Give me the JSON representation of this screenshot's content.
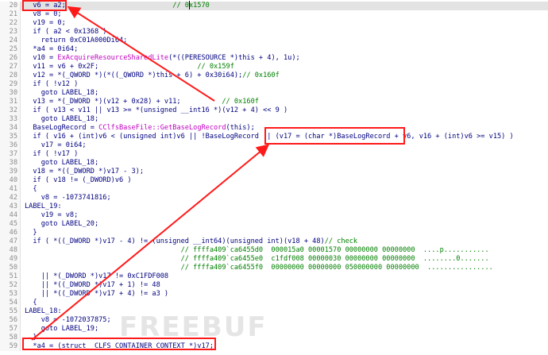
{
  "watermark": "FREEBUF",
  "lines": [
    {
      "n": "20",
      "hl": true,
      "p": [
        {
          "t": "  v6 = a2;                          "
        },
        {
          "t": "// 0x1570",
          "c": "cmt"
        }
      ]
    },
    {
      "n": "21",
      "p": [
        {
          "t": "  v8 = 0;"
        }
      ]
    },
    {
      "n": "22",
      "p": [
        {
          "t": "  v19 = 0;"
        }
      ]
    },
    {
      "n": "23",
      "p": [
        {
          "t": "  if ( a2 < 0x1368 )"
        }
      ]
    },
    {
      "n": "24",
      "p": [
        {
          "t": "    return 0xC01A000Di64;"
        }
      ]
    },
    {
      "n": "25",
      "p": [
        {
          "t": "  *a4 = 0i64;"
        }
      ]
    },
    {
      "n": "26",
      "p": [
        {
          "t": "  v10 = "
        },
        {
          "t": "ExAcquireResourceSharedLite",
          "c": "fn"
        },
        {
          "t": "(*((PERESOURCE *)this + 4), 1u);"
        }
      ]
    },
    {
      "n": "27",
      "p": [
        {
          "t": "  v11 = v6 + 0x2F;                        "
        },
        {
          "t": "// 0x159f",
          "c": "cmt"
        }
      ]
    },
    {
      "n": "28",
      "p": [
        {
          "t": "  v12 = *(_QWORD *)(*((_QWORD *)this + 6) + 0x30i64);"
        },
        {
          "t": "// 0x160f",
          "c": "cmt"
        }
      ]
    },
    {
      "n": "29",
      "p": [
        {
          "t": "  if ( !v12 )"
        }
      ]
    },
    {
      "n": "30",
      "p": [
        {
          "t": "    goto LABEL_18;"
        }
      ]
    },
    {
      "n": "31",
      "p": [
        {
          "t": "  v13 = *(_DWORD *)(v12 + 0x28) + v11;          "
        },
        {
          "t": "// 0x160f",
          "c": "cmt"
        }
      ]
    },
    {
      "n": "32",
      "p": [
        {
          "t": "  if ( v13 < v11 || v13 >= *(unsigned __int16 *)(v12 + 4) << 9 )"
        }
      ]
    },
    {
      "n": "33",
      "p": [
        {
          "t": "    goto LABEL_18;"
        }
      ]
    },
    {
      "n": "34",
      "p": [
        {
          "t": "  BaseLogRecord = "
        },
        {
          "t": "CClfsBaseFile::GetBaseLogRecord",
          "c": "fn"
        },
        {
          "t": "(this);"
        }
      ]
    },
    {
      "n": "35",
      "p": [
        {
          "t": "  if ( v16 + (int)v6 < (unsigned int)v6 || !BaseLogRecord || (v17 = (char *)BaseLogRecord + v6, v16 + (int)v6 >= v15) )"
        }
      ]
    },
    {
      "n": "36",
      "p": [
        {
          "t": "    v17 = 0i64;"
        }
      ]
    },
    {
      "n": "37",
      "p": [
        {
          "t": "  if ( !v17 )"
        }
      ]
    },
    {
      "n": "38",
      "p": [
        {
          "t": "    goto LABEL_18;"
        }
      ]
    },
    {
      "n": "39",
      "p": [
        {
          "t": "  v18 = *((_DWORD *)v17 - 3);"
        }
      ]
    },
    {
      "n": "40",
      "p": [
        {
          "t": "  if ( v18 != (_DWORD)v6 )"
        }
      ]
    },
    {
      "n": "41",
      "p": [
        {
          "t": "  {"
        }
      ]
    },
    {
      "n": "42",
      "p": [
        {
          "t": "    v8 = -1073741816;"
        }
      ]
    },
    {
      "n": "43",
      "p": [
        {
          "t": "LABEL_19:"
        }
      ]
    },
    {
      "n": "44",
      "p": [
        {
          "t": "    v19 = v8;"
        }
      ]
    },
    {
      "n": "45",
      "p": [
        {
          "t": "    goto LABEL_20;"
        }
      ]
    },
    {
      "n": "46",
      "p": [
        {
          "t": "  }"
        }
      ]
    },
    {
      "n": "47",
      "p": [
        {
          "t": "  if ( *((_DWORD *)v17 - 4) != (unsigned __int64)(unsigned int)(v18 + 48)"
        },
        {
          "t": "// check",
          "c": "cmt"
        }
      ]
    },
    {
      "n": "48",
      "p": [
        {
          "t": "                                      "
        },
        {
          "t": "// ffffa409`ca6455d0  000015a0 00001570 00000000 00000000  ....p...........",
          "c": "cmt"
        }
      ]
    },
    {
      "n": "49",
      "p": [
        {
          "t": "                                      "
        },
        {
          "t": "// ffffa409`ca6455e0  c1fdf008 00000030 00000000 00000000  ........0.......",
          "c": "cmt"
        }
      ]
    },
    {
      "n": "50",
      "p": [
        {
          "t": "                                      "
        },
        {
          "t": "// ffffa409`ca6455f0  00000000 00000000 050000000 00000000  ................",
          "c": "cmt"
        }
      ]
    },
    {
      "n": "51",
      "p": [
        {
          "t": "    || *(_DWORD *)v17 != 0xC1FDF008"
        }
      ]
    },
    {
      "n": "52",
      "p": [
        {
          "t": "    || *((_DWORD *)v17 + 1) != 48"
        }
      ]
    },
    {
      "n": "53",
      "p": [
        {
          "t": "    || *((_DWORD *)v17 + 4) != a3 )"
        }
      ]
    },
    {
      "n": "54",
      "p": [
        {
          "t": "  {"
        }
      ]
    },
    {
      "n": "55",
      "p": [
        {
          "t": "LABEL_18:"
        }
      ]
    },
    {
      "n": "56",
      "p": [
        {
          "t": "    v8 = -1072037875;"
        }
      ]
    },
    {
      "n": "57",
      "p": [
        {
          "t": "    goto LABEL_19;"
        }
      ]
    },
    {
      "n": "58",
      "p": [
        {
          "t": "  }"
        }
      ]
    },
    {
      "n": "59",
      "p": [
        {
          "t": "  *a4 = (struct _CLFS_CONTAINER_CONTEXT *)v17;"
        }
      ]
    }
  ]
}
